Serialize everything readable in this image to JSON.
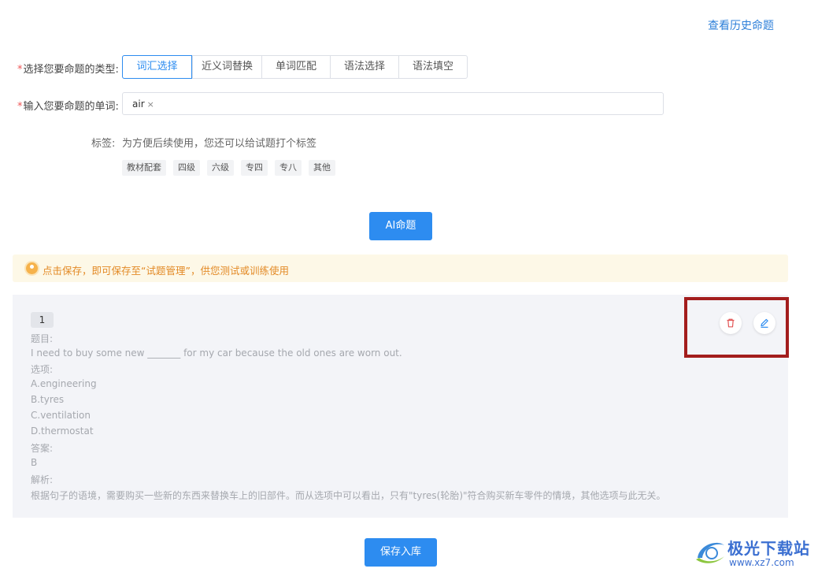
{
  "header": {
    "history_link": "查看历史命题"
  },
  "form": {
    "type_label": "选择您要命题的类型:",
    "types": [
      "词汇选择",
      "近义词替换",
      "单词匹配",
      "语法选择",
      "语法填空"
    ],
    "active_type": "词汇选择",
    "word_label": "输入您要命题的单词:",
    "word_tag": "air",
    "word_tag_close": "×",
    "tag_label": "标签:",
    "tag_hint": "为方便后续使用，您还可以给试题打个标签",
    "tags": [
      "教材配套",
      "四级",
      "六级",
      "专四",
      "专八",
      "其他"
    ]
  },
  "ai_button": "AI命题",
  "notice": "点击保存，即可保存至“试题管理”，供您测试或训练使用",
  "question": {
    "number": "1",
    "title_label": "题目:",
    "text": "I need to buy some new _______ for my car because the old ones are worn out.",
    "options_label": "选项:",
    "options": [
      "A.engineering",
      "B.tyres",
      "C.ventilation",
      "D.thermostat"
    ],
    "answer_label": "答案:",
    "answer": "B",
    "analysis_label": "解析:",
    "analysis": "根据句子的语境，需要购买一些新的东西来替换车上的旧部件。而从选项中可以看出，只有\"tyres(轮胎)\"符合购买新车零件的情境，其他选项与此无关。"
  },
  "save_button": "保存入库",
  "watermark": {
    "title": "极光下载站",
    "url": "www.xz7.com"
  },
  "colors": {
    "primary": "#2d8cf0",
    "notice_text": "#e38a26",
    "highlight": "#a31d1d"
  }
}
